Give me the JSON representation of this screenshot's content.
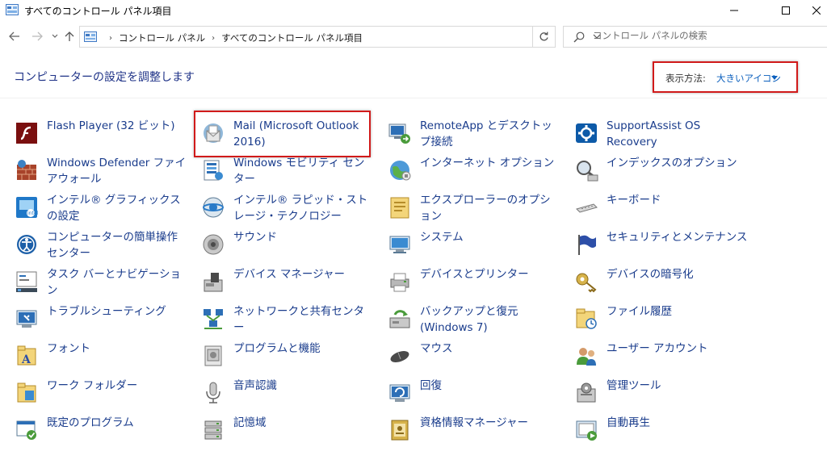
{
  "window": {
    "title": "すべてのコントロール パネル項目"
  },
  "address": {
    "crumbs": [
      "コントロール パネル",
      "すべてのコントロール パネル項目"
    ]
  },
  "search": {
    "placeholder": "コントロール パネルの検索"
  },
  "header": {
    "title": "コンピューターの設定を調整します",
    "view_label": "表示方法:",
    "view_value": "大きいアイコン"
  },
  "items": [
    {
      "label": "Flash Player (32 ビット)",
      "icon": "flash-icon"
    },
    {
      "label": "Mail (Microsoft Outlook 2016)",
      "icon": "mail-icon"
    },
    {
      "label": "RemoteApp とデスクトップ接続",
      "icon": "remoteapp-icon"
    },
    {
      "label": "SupportAssist OS Recovery",
      "icon": "supportassist-icon"
    },
    {
      "label": "Windows Defender ファイアウォール",
      "icon": "firewall-icon"
    },
    {
      "label": "Windows モビリティ センター",
      "icon": "mobility-icon"
    },
    {
      "label": "インターネット オプション",
      "icon": "internet-icon"
    },
    {
      "label": "インデックスのオプション",
      "icon": "index-icon"
    },
    {
      "label": "インテル® グラフィックスの設定",
      "icon": "intel-graphics-icon"
    },
    {
      "label": "インテル® ラピッド・ストレージ・テクノロジー",
      "icon": "intel-storage-icon"
    },
    {
      "label": "エクスプローラーのオプション",
      "icon": "folder-options-icon"
    },
    {
      "label": "キーボード",
      "icon": "keyboard-icon"
    },
    {
      "label": "コンピューターの簡単操作センター",
      "icon": "ease-of-access-icon"
    },
    {
      "label": "サウンド",
      "icon": "sound-icon"
    },
    {
      "label": "システム",
      "icon": "system-icon"
    },
    {
      "label": "セキュリティとメンテナンス",
      "icon": "security-flag-icon"
    },
    {
      "label": "タスク バーとナビゲーション",
      "icon": "taskbar-icon"
    },
    {
      "label": "デバイス マネージャー",
      "icon": "device-manager-icon"
    },
    {
      "label": "デバイスとプリンター",
      "icon": "printer-icon"
    },
    {
      "label": "デバイスの暗号化",
      "icon": "encryption-key-icon"
    },
    {
      "label": "トラブルシューティング",
      "icon": "troubleshoot-icon"
    },
    {
      "label": "ネットワークと共有センター",
      "icon": "network-icon"
    },
    {
      "label": "バックアップと復元 (Windows 7)",
      "icon": "backup-icon"
    },
    {
      "label": "ファイル履歴",
      "icon": "file-history-icon"
    },
    {
      "label": "フォント",
      "icon": "font-icon"
    },
    {
      "label": "プログラムと機能",
      "icon": "programs-icon"
    },
    {
      "label": "マウス",
      "icon": "mouse-icon"
    },
    {
      "label": "ユーザー アカウント",
      "icon": "user-accounts-icon"
    },
    {
      "label": "ワーク フォルダー",
      "icon": "work-folders-icon"
    },
    {
      "label": "音声認識",
      "icon": "microphone-icon"
    },
    {
      "label": "回復",
      "icon": "recovery-icon"
    },
    {
      "label": "管理ツール",
      "icon": "admin-tools-icon"
    },
    {
      "label": "既定のプログラム",
      "icon": "default-programs-icon"
    },
    {
      "label": "記憶域",
      "icon": "storage-spaces-icon"
    },
    {
      "label": "資格情報マネージャー",
      "icon": "credential-icon"
    },
    {
      "label": "自動再生",
      "icon": "autoplay-icon"
    }
  ]
}
